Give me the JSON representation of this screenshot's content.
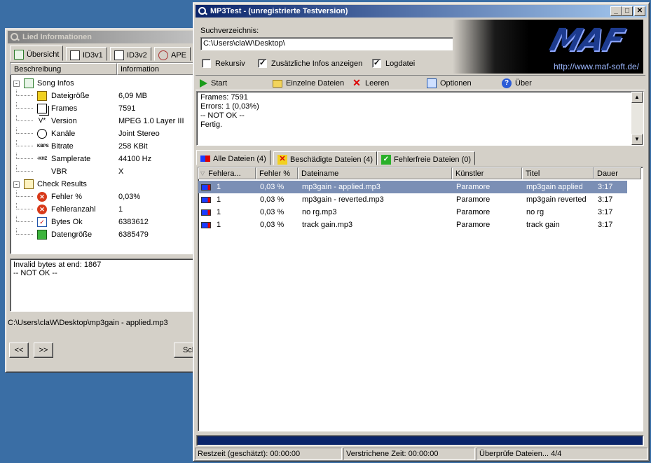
{
  "lied_window": {
    "title": "Lied Informationen",
    "tabs": [
      "Übersicht",
      "ID3v1",
      "ID3v2",
      "APE"
    ],
    "columns": [
      "Beschreibung",
      "Information"
    ],
    "song_infos_label": "Song Infos",
    "song_infos": [
      {
        "label": "Dateigröße",
        "value": "6,09 MB",
        "icon": "cube-yellow-icon"
      },
      {
        "label": "Frames",
        "value": "7591",
        "icon": "frames-icon"
      },
      {
        "label": "Version",
        "value": "MPEG 1.0 Layer III",
        "icon": "version-icon"
      },
      {
        "label": "Kanäle",
        "value": "Joint Stereo",
        "icon": "channels-icon"
      },
      {
        "label": "Bitrate",
        "value": "258 KBit",
        "icon": "kbps-icon"
      },
      {
        "label": "Samplerate",
        "value": "44100 Hz",
        "icon": "khz-icon"
      },
      {
        "label": "VBR",
        "value": "X",
        "icon": ""
      }
    ],
    "kbps_text": "KBPS",
    "khz_text": "-KHZ",
    "version_text": "V*",
    "check_results_label": "Check Results",
    "check_results": [
      {
        "label": "Fehler %",
        "value": "0,03%",
        "icon": "error-icon"
      },
      {
        "label": "Fehleranzahl",
        "value": "1",
        "icon": "error-icon"
      },
      {
        "label": "Bytes Ok",
        "value": "6383612",
        "icon": "checklist-icon"
      },
      {
        "label": "Datengröße",
        "value": "6385479",
        "icon": "cube-green-icon"
      }
    ],
    "log_lines": [
      "Invalid bytes at end: 1867",
      "-- NOT OK --"
    ],
    "file_path": "C:\\Users\\claW\\Desktop\\mp3gain - applied.mp3",
    "prev_label": "<<",
    "next_label": ">>",
    "close_partial": "Sch"
  },
  "main_window": {
    "title": "MP3Test -  (unregistrierte Testversion)",
    "suchverzeichnis_label": "Suchverzeichnis:",
    "path_value": "C:\\Users\\claW\\Desktop\\",
    "browse_label": "...",
    "options": [
      {
        "label": "Rekursiv",
        "checked": false
      },
      {
        "label": "Zusätzliche Infos anzeigen",
        "checked": true
      },
      {
        "label": "Logdatei",
        "checked": true
      }
    ],
    "logo_text": "MAF",
    "logo_url": "http://www.maf-soft.de/",
    "toolbar": [
      {
        "label": "Start",
        "icon": "play-icon"
      },
      {
        "label": "Einzelne Dateien",
        "icon": "folder-open-icon"
      },
      {
        "label": "Leeren",
        "icon": "clear-x-icon"
      },
      {
        "label": "Optionen",
        "icon": "options-icon"
      },
      {
        "label": "Über",
        "icon": "help-icon"
      }
    ],
    "output_lines": [
      "Frames: 7591",
      "Errors: 1 (0,03%)",
      "-- NOT OK --",
      "Fertig."
    ],
    "tabs": [
      "Alle Dateien (4)",
      "Beschädigte Dateien (4)",
      "Fehlerfreie Dateien (0)"
    ],
    "columns": [
      "Fehlera...",
      "Fehler %",
      "Dateiname",
      "Künstler",
      "Titel",
      "Dauer"
    ],
    "rows": [
      {
        "errors": "1",
        "pct": "0,03 %",
        "file": "mp3gain - applied.mp3",
        "artist": "Paramore",
        "title": "mp3gain applied",
        "duration": "3:17",
        "selected": true
      },
      {
        "errors": "1",
        "pct": "0,03 %",
        "file": "mp3gain - reverted.mp3",
        "artist": "Paramore",
        "title": "mp3gain reverted",
        "duration": "3:17",
        "selected": false
      },
      {
        "errors": "1",
        "pct": "0,03 %",
        "file": "no rg.mp3",
        "artist": "Paramore",
        "title": "no rg",
        "duration": "3:17",
        "selected": false
      },
      {
        "errors": "1",
        "pct": "0,03 %",
        "file": "track gain.mp3",
        "artist": "Paramore",
        "title": "track gain",
        "duration": "3:17",
        "selected": false
      }
    ],
    "status": [
      "Restzeit (geschätzt): 00:00:00",
      "Verstrichene Zeit: 00:00:00",
      "Überprüfe Dateien... 4/4"
    ]
  },
  "colors": {
    "desktop": "#3a6ea5",
    "title_active": "#0a246a",
    "progress": "#0a246a",
    "row_selected": "#7b8fb5"
  }
}
